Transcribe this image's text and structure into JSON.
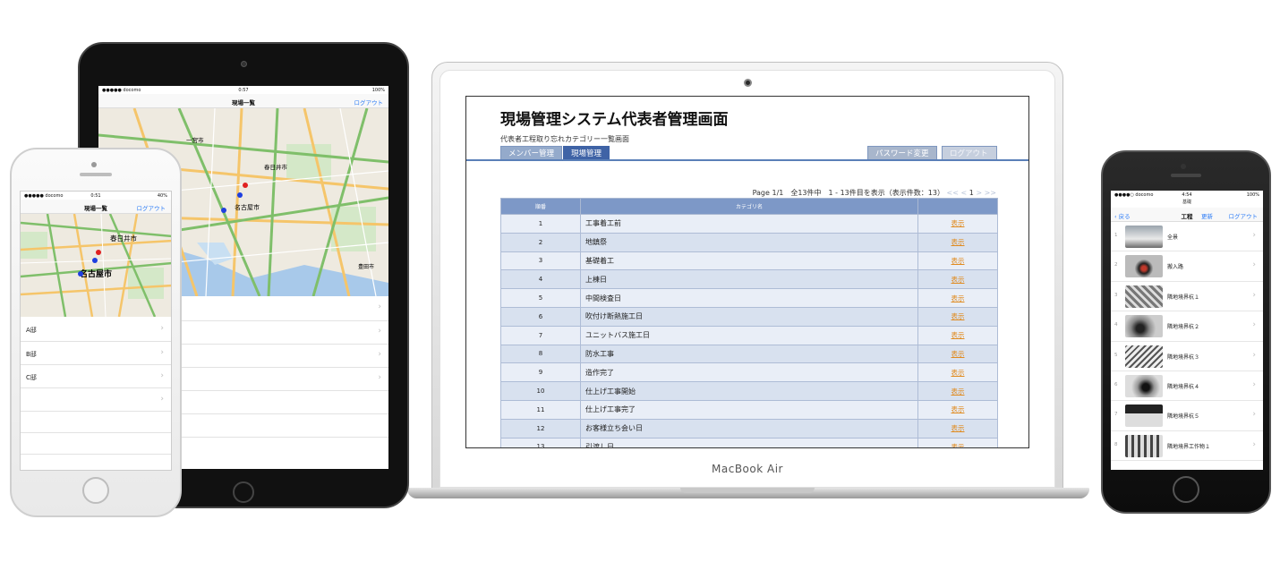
{
  "laptop": {
    "brand": "MacBook Air",
    "web": {
      "title": "現場管理システム代表者管理画面",
      "subtitle": "代表者工程取り忘れカテゴリー一覧画面",
      "tabs": {
        "members": "メンバー管理",
        "sites": "現場管理",
        "password": "パスワード変更",
        "logout": "ログアウト"
      },
      "pager": {
        "info": "Page 1/1　全13件中　1 - 13件目を表示（表示件数：13）",
        "nav_prev": "<< <",
        "nav_page": "1",
        "nav_next": "> >>"
      },
      "columns": {
        "order": "順番",
        "category": "カテゴリ名",
        "action": ""
      },
      "link_label": "表示",
      "rows": [
        {
          "n": "1",
          "name": "工事着工前"
        },
        {
          "n": "2",
          "name": "地鎮祭"
        },
        {
          "n": "3",
          "name": "基礎着工"
        },
        {
          "n": "4",
          "name": "上棟日"
        },
        {
          "n": "5",
          "name": "中間検査日"
        },
        {
          "n": "6",
          "name": "吹付け断熱施工日"
        },
        {
          "n": "7",
          "name": "ユニットバス施工日"
        },
        {
          "n": "8",
          "name": "防水工事"
        },
        {
          "n": "9",
          "name": "造作完了"
        },
        {
          "n": "10",
          "name": "仕上げ工事開始"
        },
        {
          "n": "11",
          "name": "仕上げ工事完了"
        },
        {
          "n": "12",
          "name": "お客様立ち会い日"
        },
        {
          "n": "13",
          "name": "引渡し日"
        }
      ]
    }
  },
  "tablet": {
    "status": {
      "carrier": "●●●●● docomo",
      "time": "0:57",
      "battery": "100%"
    },
    "nav": {
      "title": "現場一覧",
      "logout": "ログアウト"
    },
    "map": {
      "city1": "一宮市",
      "city2": "春日井市",
      "city3": "名古屋市",
      "city4": "豊田市"
    }
  },
  "phone_left": {
    "status": {
      "carrier": "●●●●● docomo",
      "time": "0:51",
      "battery": "40%"
    },
    "nav": {
      "title": "現場一覧",
      "logout": "ログアウト"
    },
    "map": {
      "city1": "春日井市",
      "city2": "名古屋市"
    },
    "items": [
      "A邸",
      "B邸",
      "C邸"
    ]
  },
  "phone_right": {
    "status": {
      "carrier": "●●●●○ docomo",
      "time": "4:54",
      "battery": "100%"
    },
    "subtitle": "基礎",
    "nav": {
      "back": "戻る",
      "title": "工程",
      "refresh": "更新",
      "logout": "ログアウト"
    },
    "items": [
      {
        "n": "1",
        "name": "全景"
      },
      {
        "n": "2",
        "name": "搬入路"
      },
      {
        "n": "3",
        "name": "隣地境界杭１"
      },
      {
        "n": "4",
        "name": "隣地境界杭２"
      },
      {
        "n": "5",
        "name": "隣地境界杭３"
      },
      {
        "n": "6",
        "name": "隣地境界杭４"
      },
      {
        "n": "7",
        "name": "隣地境界杭５"
      },
      {
        "n": "8",
        "name": "隣地境界工作物１"
      }
    ]
  }
}
